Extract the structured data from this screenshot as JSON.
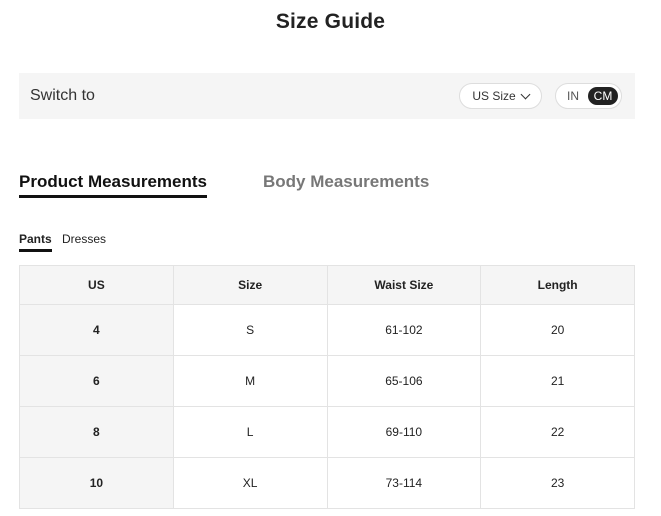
{
  "page": {
    "title": "Size Guide"
  },
  "switch_bar": {
    "label": "Switch to",
    "size_select": {
      "selected": "US Size"
    },
    "unit_toggle": {
      "options": [
        "IN",
        "CM"
      ],
      "selected": "CM"
    }
  },
  "main_tabs": [
    {
      "label": "Product Measurements",
      "active": true
    },
    {
      "label": "Body Measurements",
      "active": false
    }
  ],
  "sub_tabs": [
    {
      "label": "Pants",
      "active": true
    },
    {
      "label": "Dresses",
      "active": false
    }
  ],
  "table": {
    "headers": [
      "US",
      "Size",
      "Waist Size",
      "Length"
    ],
    "rows": [
      [
        "4",
        "S",
        "61-102",
        "20"
      ],
      [
        "6",
        "M",
        "65-106",
        "21"
      ],
      [
        "8",
        "L",
        "69-110",
        "22"
      ],
      [
        "10",
        "XL",
        "73-114",
        "23"
      ]
    ]
  },
  "colors": {
    "accent": "#222222",
    "panel_bg": "#f5f5f5",
    "inactive_tab": "#777777",
    "border": "#e3e3e3"
  }
}
